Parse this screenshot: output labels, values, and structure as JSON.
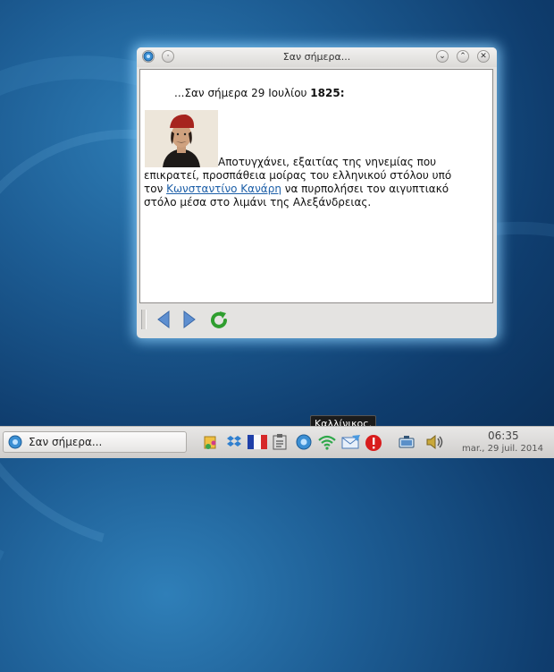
{
  "window": {
    "title": "Σαν σήμερα...",
    "content": {
      "heading_prefix": "...Σαν σήμερα 29 Ιουλίου ",
      "heading_year": "1825",
      "heading_suffix": ":",
      "text_1": "Αποτυγχάνει, εξαιτίας της νηνεμίας που επικρατεί, προσπάθεια μοίρας του ελληνικού στόλου υπό τον ",
      "link_text": "Κωνσταντίνο Κανάρη",
      "text_2": " να πυρπολήσει τον αιγυπτιακό στόλο μέσα στο λιμάνι της Αλεξάνδρειας."
    },
    "buttons": {
      "close": "✕",
      "maximize": "⌃",
      "minimize": "⌄",
      "menu": "·"
    }
  },
  "taskbar": {
    "task_label": "Σαν σήμερα...",
    "clock_time": "06:35",
    "clock_date": "mar., 29 juil. 2014",
    "tooltip": "Καλλίνικος."
  },
  "icons": {
    "back": "arrow-left-icon",
    "forward": "arrow-right-icon",
    "reload": "reload-icon"
  },
  "colors": {
    "link": "#1d5fa8",
    "desktop": "#1d5d94",
    "glow": "#8cd2ff"
  }
}
